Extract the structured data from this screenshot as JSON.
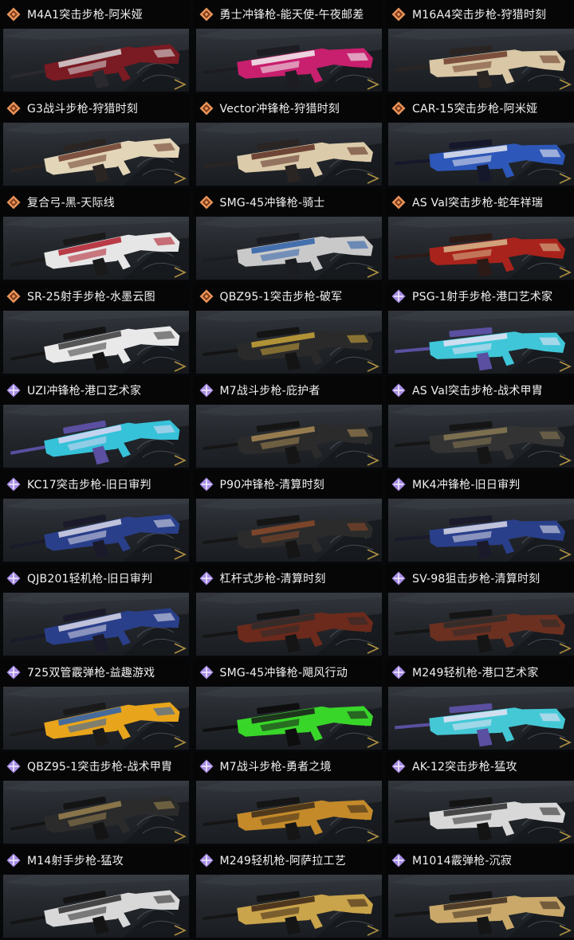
{
  "colors": {
    "legendary": "#e8935a",
    "legendary_inner": "#7a3514",
    "epic": "#a78ce6",
    "epic_inner": "#ffffff",
    "panel_top": "#33373d",
    "panel_bottom": "#1a1d21",
    "background": "#070809",
    "title_text": "#f1f1f1"
  },
  "skins": [
    {
      "title": "M4A1突击步枪-阿米娅",
      "rarity": "legendary",
      "icon": "diamond-icon",
      "colors": [
        "#7a1a22",
        "#d8d8d8",
        "#2a2a2e"
      ]
    },
    {
      "title": "勇士冲锋枪-能天使-午夜邮差",
      "rarity": "legendary",
      "icon": "diamond-icon",
      "colors": [
        "#c81f6e",
        "#f2f2f2",
        "#1c1c22"
      ]
    },
    {
      "title": "M16A4突击步枪-狩猎时刻",
      "rarity": "legendary",
      "icon": "diamond-icon",
      "colors": [
        "#d9c7a5",
        "#6b3b2a",
        "#2a2523"
      ]
    },
    {
      "title": "G3战斗步枪-狩猎时刻",
      "rarity": "legendary",
      "icon": "diamond-icon",
      "colors": [
        "#e3d5b8",
        "#6b3b2a",
        "#2a2523"
      ]
    },
    {
      "title": "Vector冲锋枪-狩猎时刻",
      "rarity": "legendary",
      "icon": "diamond-icon",
      "colors": [
        "#dccbaa",
        "#5a2e22",
        "#2a2523"
      ]
    },
    {
      "title": "CAR-15突击步枪-阿米娅",
      "rarity": "legendary",
      "icon": "diamond-icon",
      "colors": [
        "#2d57b8",
        "#e8e8f0",
        "#15182a"
      ]
    },
    {
      "title": "复合弓-黑-天际线",
      "rarity": "legendary",
      "icon": "diamond-icon",
      "colors": [
        "#e6e6e6",
        "#b01c2a",
        "#1a1a1a"
      ]
    },
    {
      "title": "SMG-45冲锋枪-骑士",
      "rarity": "legendary",
      "icon": "diamond-icon",
      "colors": [
        "#c9c9c9",
        "#2d5fa8",
        "#1c1d22"
      ]
    },
    {
      "title": "AS Val突击步枪-蛇年祥瑞",
      "rarity": "legendary",
      "icon": "diamond-icon",
      "colors": [
        "#a8231c",
        "#d7b98c",
        "#2b1a16"
      ]
    },
    {
      "title": "SR-25射手步枪-水墨云图",
      "rarity": "legendary",
      "icon": "diamond-icon",
      "colors": [
        "#e9e9e9",
        "#3a3a3a",
        "#141414"
      ]
    },
    {
      "title": "QBZ95-1突击步枪-破军",
      "rarity": "legendary",
      "icon": "diamond-icon",
      "colors": [
        "#2a2a2a",
        "#c9a43a",
        "#141414"
      ]
    },
    {
      "title": "PSG-1射手步枪-港口艺术家",
      "rarity": "epic",
      "icon": "gem-icon",
      "colors": [
        "#3fc6d8",
        "#e7e2f5",
        "#5a4fa0"
      ]
    },
    {
      "title": "UZI冲锋枪-港口艺术家",
      "rarity": "epic",
      "icon": "gem-icon",
      "colors": [
        "#36c2d9",
        "#dcd6f2",
        "#5a4fa0"
      ]
    },
    {
      "title": "M7战斗步枪-庇护者",
      "rarity": "epic",
      "icon": "gem-icon",
      "colors": [
        "#2b2b2b",
        "#a88a55",
        "#151515"
      ]
    },
    {
      "title": "AS Val突击步枪-战术甲胄",
      "rarity": "epic",
      "icon": "gem-icon",
      "colors": [
        "#333333",
        "#8a7a55",
        "#151515"
      ]
    },
    {
      "title": "KC17突击步枪-旧日审判",
      "rarity": "epic",
      "icon": "gem-icon",
      "colors": [
        "#2a3f8a",
        "#d9d9e8",
        "#1a1a2a"
      ]
    },
    {
      "title": "P90冲锋枪-清算时刻",
      "rarity": "epic",
      "icon": "gem-icon",
      "colors": [
        "#2b2b2b",
        "#8a4a2a",
        "#151515"
      ]
    },
    {
      "title": "MK4冲锋枪-旧日审判",
      "rarity": "epic",
      "icon": "gem-icon",
      "colors": [
        "#2a3f8a",
        "#d9d9e8",
        "#1a1a2a"
      ]
    },
    {
      "title": "QJB201轻机枪-旧日审判",
      "rarity": "epic",
      "icon": "gem-icon",
      "colors": [
        "#2a3f8a",
        "#d9d9e8",
        "#1a1a2a"
      ]
    },
    {
      "title": "杠杆式步枪-清算时刻",
      "rarity": "epic",
      "icon": "gem-icon",
      "colors": [
        "#6b2a1c",
        "#2b2b2b",
        "#151515"
      ]
    },
    {
      "title": "SV-98狙击步枪-清算时刻",
      "rarity": "epic",
      "icon": "gem-icon",
      "colors": [
        "#6b3020",
        "#2b2b2b",
        "#151515"
      ]
    },
    {
      "title": "725双管霰弹枪-益趣游戏",
      "rarity": "epic",
      "icon": "gem-icon",
      "colors": [
        "#e8a51c",
        "#2a5fb0",
        "#1a1a1a"
      ]
    },
    {
      "title": "SMG-45冲锋枪-飓风行动",
      "rarity": "epic",
      "icon": "gem-icon",
      "colors": [
        "#39d62a",
        "#1a1a1a",
        "#0e0e0e"
      ]
    },
    {
      "title": "M249轻机枪-港口艺术家",
      "rarity": "epic",
      "icon": "gem-icon",
      "colors": [
        "#45c8d6",
        "#e8e3f5",
        "#5a4fa0"
      ]
    },
    {
      "title": "QBZ95-1突击步枪-战术甲胄",
      "rarity": "epic",
      "icon": "gem-icon",
      "colors": [
        "#2b2b2b",
        "#9a8350",
        "#141414"
      ]
    },
    {
      "title": "M7战斗步枪-勇者之境",
      "rarity": "epic",
      "icon": "gem-icon",
      "colors": [
        "#c48a2a",
        "#3a2a1a",
        "#151515"
      ]
    },
    {
      "title": "AK-12突击步枪-猛攻",
      "rarity": "epic",
      "icon": "gem-icon",
      "colors": [
        "#d8d8d8",
        "#2b2b2b",
        "#141414"
      ]
    },
    {
      "title": "M14射手步枪-猛攻",
      "rarity": "epic",
      "icon": "gem-icon",
      "colors": [
        "#d8d8d8",
        "#2b2b2b",
        "#141414"
      ]
    },
    {
      "title": "M249轻机枪-阿萨拉工艺",
      "rarity": "epic",
      "icon": "gem-icon",
      "colors": [
        "#c9a44a",
        "#3a2418",
        "#151515"
      ]
    },
    {
      "title": "M1014霰弹枪-沉寂",
      "rarity": "epic",
      "icon": "gem-icon",
      "colors": [
        "#c9a86a",
        "#3a2a1e",
        "#151515"
      ]
    }
  ]
}
